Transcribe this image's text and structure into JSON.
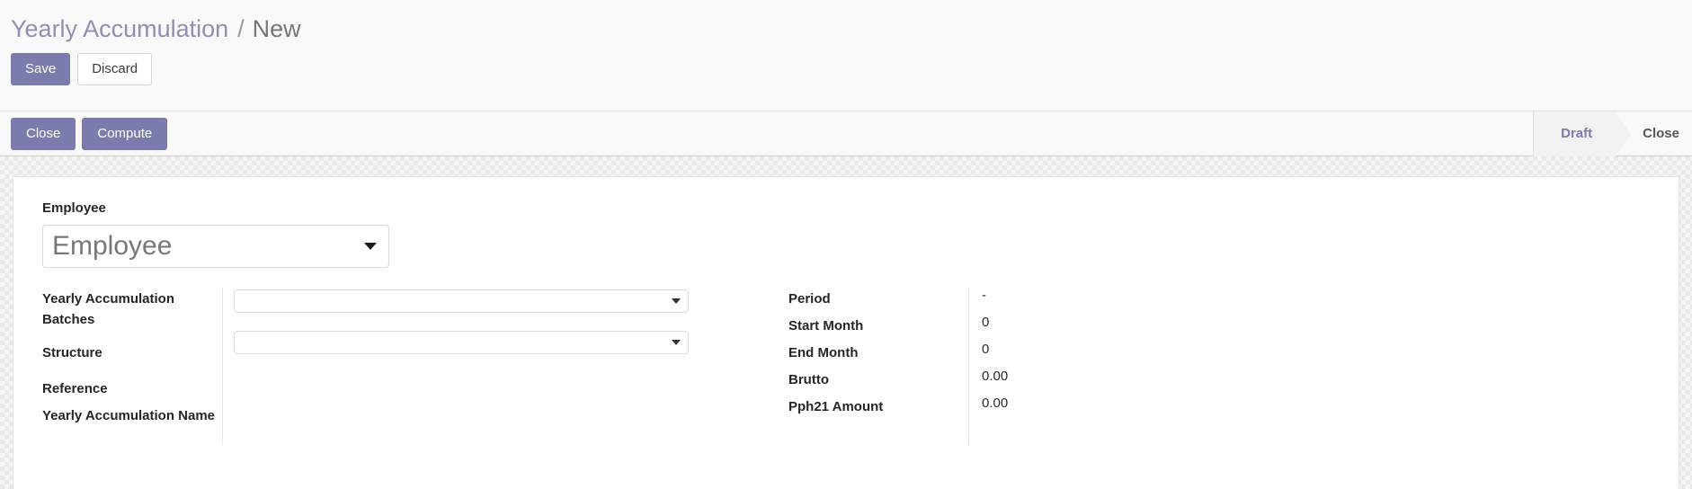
{
  "breadcrumb": {
    "root": "Yearly Accumulation",
    "separator": "/",
    "current": "New"
  },
  "actions": {
    "save_label": "Save",
    "discard_label": "Discard"
  },
  "statusbar": {
    "buttons": [
      {
        "label": "Close",
        "style": "primary"
      },
      {
        "label": "Compute",
        "style": "primary"
      }
    ],
    "states": [
      {
        "label": "Draft",
        "active": true
      },
      {
        "label": "Close",
        "active": false
      }
    ]
  },
  "form": {
    "employee": {
      "label": "Employee",
      "value": "Employee",
      "placeholder": "Employee"
    },
    "left_column": {
      "labels": [
        "Yearly Accumulation Batches",
        "Structure",
        "Reference",
        "Yearly Accumulation Name"
      ],
      "fields": [
        {
          "name": "yearly_accumulation_batches",
          "value": "",
          "placeholder": ""
        },
        {
          "name": "structure",
          "value": "",
          "placeholder": ""
        }
      ]
    },
    "right_column": {
      "rows": [
        {
          "label": "Period",
          "value": "-"
        },
        {
          "label": "Start Month",
          "value": "0"
        },
        {
          "label": "End Month",
          "value": "0"
        },
        {
          "label": "Brutto",
          "value": "0.00"
        },
        {
          "label": "Pph21 Amount",
          "value": "0.00"
        }
      ]
    }
  },
  "colors": {
    "primary": "#7c7bad",
    "breadcrumb_link": "#8f8fb3",
    "panel_bg": "#f9f9f9"
  }
}
